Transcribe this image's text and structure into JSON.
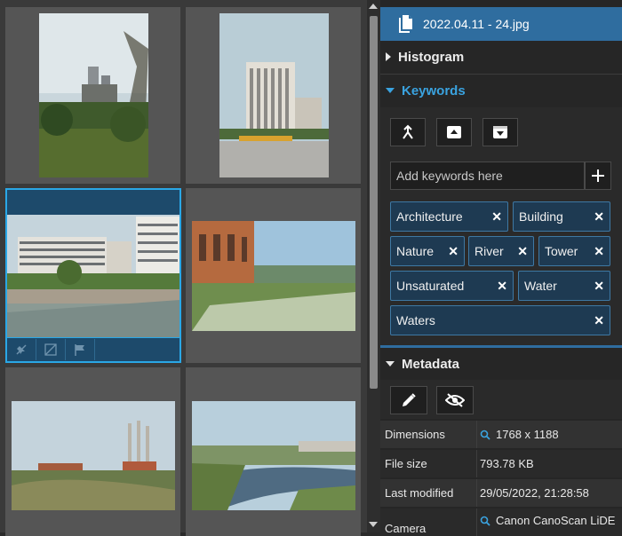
{
  "file": {
    "name": "2022.04.11 - 24.jpg",
    "icon": "file-copy-icon"
  },
  "sections": {
    "histogram": {
      "label": "Histogram",
      "expanded": false
    },
    "keywords": {
      "label": "Keywords",
      "expanded": true
    },
    "metadata": {
      "label": "Metadata",
      "expanded": true
    }
  },
  "keywords": {
    "placeholder": "Add keywords here",
    "tags": [
      "Architecture",
      "Building",
      "Nature",
      "River",
      "Tower",
      "Unsaturated",
      "Water",
      "Waters"
    ],
    "remove_glyph": "✕"
  },
  "metadata": {
    "rows": [
      {
        "key": "Dimensions",
        "value": "1768 x 1188",
        "searchable": true
      },
      {
        "key": "File size",
        "value": "793.78 KB",
        "searchable": false
      },
      {
        "key": "Last modified",
        "value": "29/05/2022, 21:28:58",
        "searchable": false
      },
      {
        "key": "Camera",
        "value": "Canon CanoScan LiDE",
        "searchable": true
      }
    ]
  },
  "colors": {
    "accent": "#2f6d9f",
    "highlight": "#3aa3e0",
    "selection_border": "#2aa7e6",
    "tag_bg": "#1e3a52"
  }
}
